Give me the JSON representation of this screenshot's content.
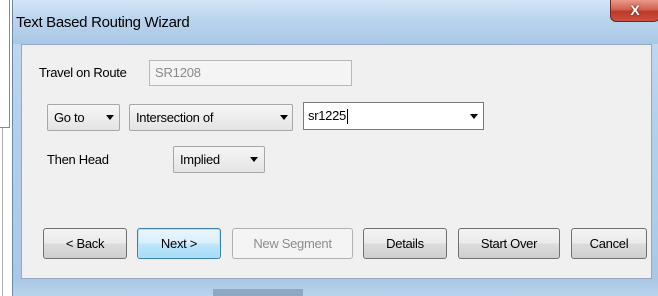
{
  "window": {
    "title": "Text Based Routing Wizard",
    "close_glyph": "X"
  },
  "route": {
    "label": "Travel on Route",
    "value": "SR1208"
  },
  "goto_row": {
    "action": {
      "selected": "Go to"
    },
    "target_type": {
      "selected": "Intersection of"
    },
    "target_value": {
      "value": "sr1225"
    }
  },
  "heading_row": {
    "label": "Then Head",
    "direction": {
      "selected": "Implied"
    }
  },
  "buttons": {
    "back": "< Back",
    "next": "Next >",
    "new_segment": "New Segment",
    "details": "Details",
    "start_over": "Start Over",
    "cancel": "Cancel"
  },
  "colors": {
    "title_bar": "#bcd5ee",
    "close_button": "#c9503f",
    "default_button_border": "#3c7fb1",
    "client_background": "#f0f0f0"
  }
}
